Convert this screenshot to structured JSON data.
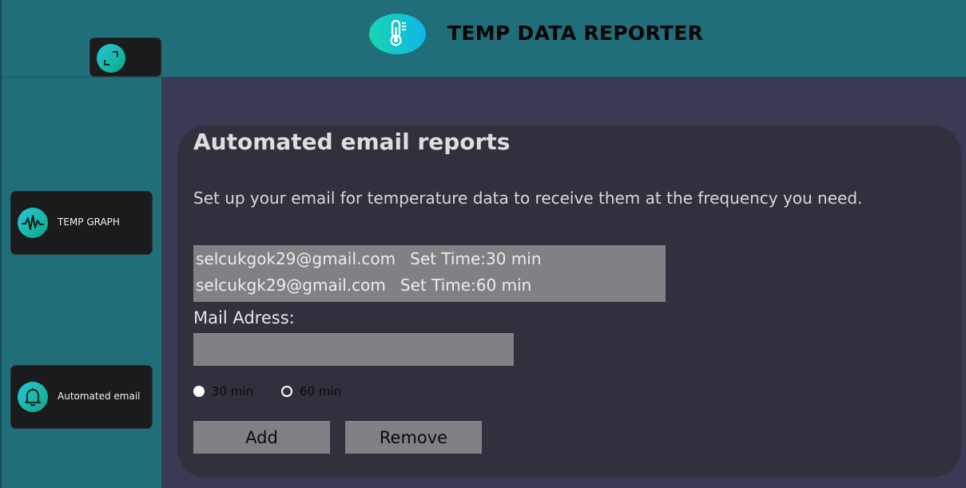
{
  "header": {
    "title": "TEMP DATA REPORTER",
    "logo_icon": "thermometer-icon",
    "toggle_icon": "expand-icon"
  },
  "sidebar": {
    "items": [
      {
        "label": "TEMP GRAPH",
        "icon": "waveform-icon"
      },
      {
        "label": "Automated email",
        "icon": "bell-icon"
      }
    ]
  },
  "main": {
    "title": "Automated email reports",
    "description": "Set up your email for temperature data to receive them at the frequency you need.",
    "email_list": [
      {
        "email": "selcukgok29@gmail.com",
        "schedule": "Set Time:30 min"
      },
      {
        "email": "selcukgk29@gmail.com",
        "schedule": "Set Time:60 min"
      }
    ],
    "mail_label": "Mail Adress:",
    "mail_value": "",
    "options": [
      {
        "label": "30 min",
        "selected": true
      },
      {
        "label": "60 min",
        "selected": false
      }
    ],
    "add_label": "Add",
    "remove_label": "Remove"
  },
  "colors": {
    "header_bg": "#1f6e7a",
    "main_bg": "#3a3a55",
    "card_bg": "#31313e",
    "input_bg": "#808184",
    "nav_button_bg": "#1b1b1d",
    "accent_gradient_start": "#27c6dc",
    "accent_gradient_end": "#0fa48a"
  }
}
